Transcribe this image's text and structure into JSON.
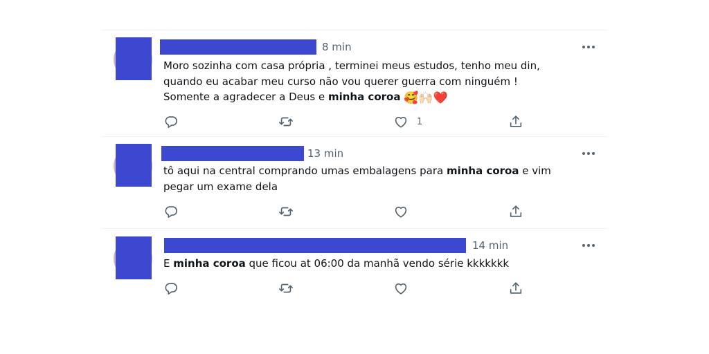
{
  "tweets": [
    {
      "time": "8 min",
      "lines": [
        {
          "parts": [
            {
              "t": "Moro sozinha com casa própria , terminei meus estudos, tenho meu din,"
            }
          ]
        },
        {
          "parts": [
            {
              "t": "quando eu acabar meu curso não vou querer guerra com ninguém !"
            }
          ]
        },
        {
          "parts": [
            {
              "t": "Somente a agradecer a Deus e "
            },
            {
              "t": "minha coroa",
              "b": true
            },
            {
              "t": " "
            },
            {
              "t": "🥰🙌🏻❤️",
              "emoji": true
            }
          ]
        }
      ],
      "reply_count": "",
      "retweet_count": "",
      "like_count": "1"
    },
    {
      "time": "13 min",
      "lines": [
        {
          "parts": [
            {
              "t": "tô aqui na central comprando umas embalagens para "
            },
            {
              "t": "minha coroa",
              "b": true
            },
            {
              "t": " e vim"
            }
          ]
        },
        {
          "parts": [
            {
              "t": "pegar um exame dela"
            }
          ]
        }
      ],
      "reply_count": "",
      "retweet_count": "",
      "like_count": ""
    },
    {
      "time": "14 min",
      "lines": [
        {
          "parts": [
            {
              "t": "E "
            },
            {
              "t": "minha coroa",
              "b": true
            },
            {
              "t": " que ficou at 06:00 da manhã vendo série kkkkkkk"
            }
          ]
        }
      ],
      "reply_count": "",
      "retweet_count": "",
      "like_count": ""
    }
  ],
  "icons": {
    "reply": "reply-icon",
    "retweet": "retweet-icon",
    "like": "heart-icon",
    "share": "share-icon",
    "more": "more-icon"
  },
  "colors": {
    "censor": "#3d48d1",
    "muted": "#536471",
    "divider": "#eff3f4"
  }
}
